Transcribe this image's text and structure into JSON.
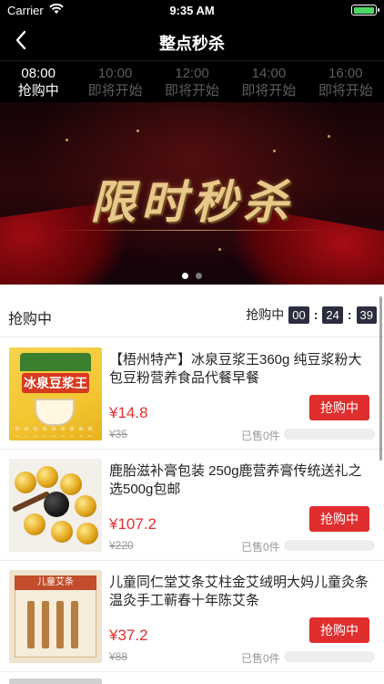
{
  "status_bar": {
    "carrier": "Carrier",
    "time": "9:35 AM",
    "battery_level": 1.0
  },
  "nav": {
    "title": "整点秒杀",
    "back_icon": "chevron-left-icon"
  },
  "time_tabs": [
    {
      "time": "08:00",
      "status": "抢购中",
      "active": true
    },
    {
      "time": "10:00",
      "status": "即将开始",
      "active": false
    },
    {
      "time": "12:00",
      "status": "即将开始",
      "active": false
    },
    {
      "time": "14:00",
      "status": "即将开始",
      "active": false
    },
    {
      "time": "16:00",
      "status": "即将开始",
      "active": false
    }
  ],
  "banner": {
    "title": "限时秒杀",
    "page_count": 2,
    "active_page": 1
  },
  "section": {
    "title": "抢购中",
    "countdown_label": "抢购中",
    "countdown": {
      "hours": "00",
      "minutes": "24",
      "seconds": "39"
    }
  },
  "products": [
    {
      "name": "【梧州特产】冰泉豆浆王360g 纯豆浆粉大包豆粉营养食品代餐早餐",
      "price": "¥14.8",
      "original_price": "¥35",
      "sold_text": "已售0件",
      "sold_progress": 0.0,
      "button_label": "抢购中",
      "image_text": "冰泉豆浆王"
    },
    {
      "name": "鹿胎滋补膏包装 250g鹿营养膏传统送礼之选500g包邮",
      "price": "¥107.2",
      "original_price": "¥220",
      "sold_text": "已售0件",
      "sold_progress": 0.0,
      "button_label": "抢购中"
    },
    {
      "name": "儿童同仁堂艾条艾柱金艾绒明大妈儿童灸条温灸手工蕲春十年陈艾条",
      "price": "¥37.2",
      "original_price": "¥88",
      "sold_text": "已售0件",
      "sold_progress": 0.0,
      "button_label": "抢购中",
      "image_text": "儿童艾条"
    }
  ],
  "colors": {
    "accent_red": "#e02d2d",
    "price_red": "#e03030",
    "countdown_bg": "#2b2d3f",
    "header_bg": "#000000"
  }
}
